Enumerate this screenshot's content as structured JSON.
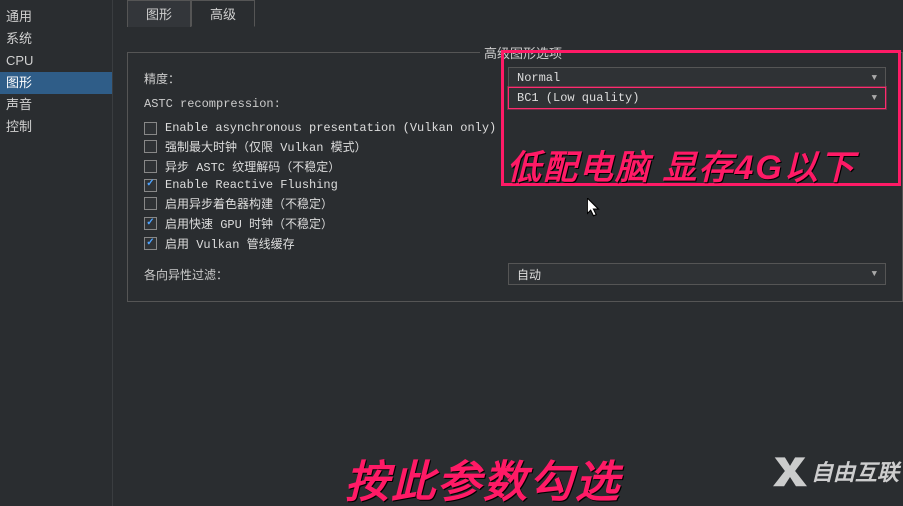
{
  "sidebar": {
    "items": [
      {
        "label": "通用"
      },
      {
        "label": "系统"
      },
      {
        "label": "CPU"
      },
      {
        "label": "图形",
        "selected": true
      },
      {
        "label": "声音"
      },
      {
        "label": "控制"
      }
    ]
  },
  "tabs": [
    {
      "label": "图形"
    },
    {
      "label": "高级",
      "active": true
    }
  ],
  "group_title": "高级图形选项",
  "precision": {
    "label": "精度：",
    "value": "Normal"
  },
  "astc": {
    "label": "ASTC recompression:",
    "value": "BC1 (Low quality)"
  },
  "checks": [
    {
      "label": "Enable asynchronous presentation (Vulkan only)",
      "checked": false
    },
    {
      "label": "强制最大时钟（仅限 Vulkan 模式）",
      "checked": false
    },
    {
      "label": "异步 ASTC 纹理解码（不稳定）",
      "checked": false
    },
    {
      "label": "Enable Reactive Flushing",
      "checked": true
    },
    {
      "label": "启用异步着色器构建（不稳定）",
      "checked": false
    },
    {
      "label": "启用快速 GPU 时钟（不稳定）",
      "checked": true
    },
    {
      "label": "启用 Vulkan 管线缓存",
      "checked": true
    }
  ],
  "aniso": {
    "label": "各向异性过滤：",
    "value": "自动"
  },
  "annotations": {
    "low_spec": "低配电脑  显存4G以下",
    "follow_params": "按此参数勾选",
    "watermark": "自由互联"
  }
}
